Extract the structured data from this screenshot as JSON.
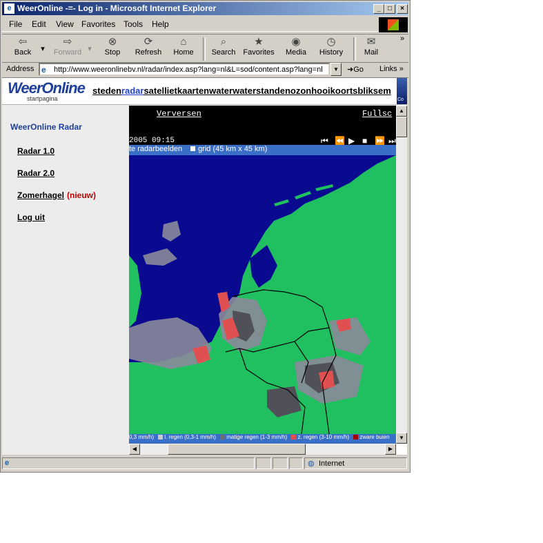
{
  "window": {
    "title": "WeerOnline -=- Log in - Microsoft Internet Explorer"
  },
  "menu": [
    "File",
    "Edit",
    "View",
    "Favorites",
    "Tools",
    "Help"
  ],
  "toolbar": {
    "back": "Back",
    "forward": "Forward",
    "stop": "Stop",
    "refresh": "Refresh",
    "home": "Home",
    "search": "Search",
    "favorites": "Favorites",
    "media": "Media",
    "history": "History",
    "mail": "Mail"
  },
  "address": {
    "label": "Address",
    "url": "http://www.weeronlinebv.nl/radar/index.asp?lang=nl&L=sod/content.asp?lang=nl",
    "go": "Go",
    "links": "Links"
  },
  "header": {
    "logo": "WeerOnline",
    "tagline": "startpagina",
    "header_image_text": "Co",
    "nav": [
      "steden",
      "radar",
      "satelliet",
      "kaarten",
      "water",
      "waterstanden",
      "ozon",
      "hooikoorts",
      "bliksem"
    ]
  },
  "sidebar": {
    "title": "WeerOnline Radar",
    "links": [
      {
        "label": "Radar 1.0"
      },
      {
        "label": "Radar 2.0"
      },
      {
        "label": "Zomerhagel",
        "badge": "(nieuw)"
      },
      {
        "label": "Log uit"
      }
    ]
  },
  "radar": {
    "refresh_link": "Verversen",
    "fullscreen_link": "Fullsc",
    "timestamp": "2005 09:15",
    "option_1": "te radarbeelden",
    "option_2": "grid (45 km x 45 km)",
    "legend": [
      {
        "label": "0,3 mm/h)",
        "color": "#c8c8c8"
      },
      {
        "label": "l. regen (0,3-1 mm/h)",
        "color": "#6e6e6e"
      },
      {
        "label": "matige regen (1-3 mm/h)",
        "color": "#e05050"
      },
      {
        "label": "z. regen (3-10 mm/h)",
        "color": "#a00000"
      },
      {
        "label": "zware buien",
        "color": ""
      }
    ],
    "colors": {
      "sea": "#0a0a90",
      "land": "#20c060",
      "rain_light": "#8a8a9a",
      "rain_moderate": "#505058",
      "rain_heavy": "#e05050"
    }
  },
  "status": {
    "zone": "Internet"
  }
}
